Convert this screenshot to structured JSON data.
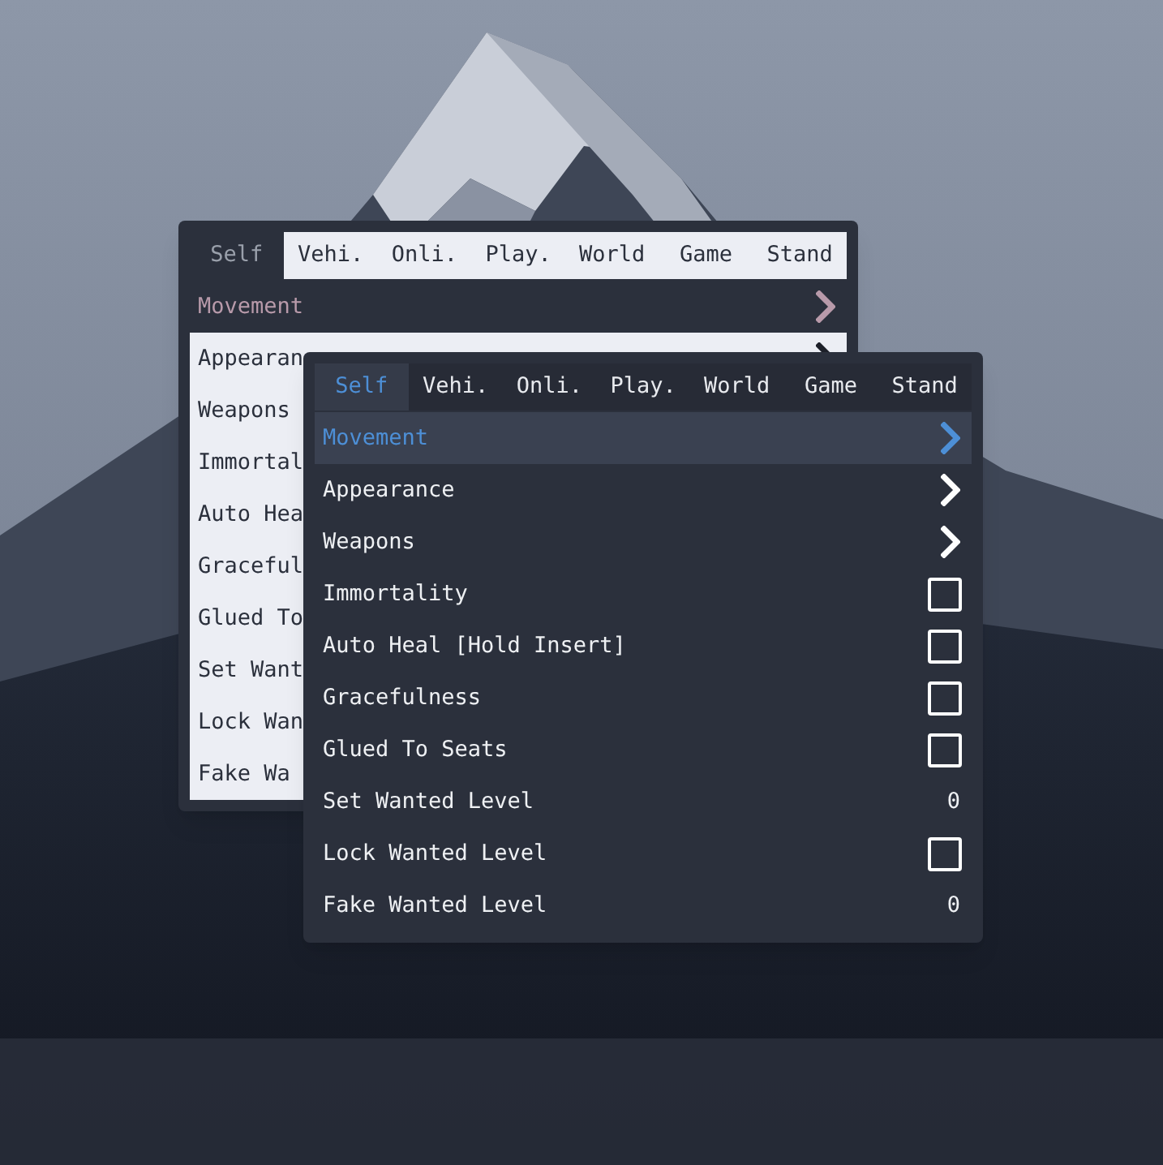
{
  "menus": [
    {
      "active": false,
      "tabs": [
        {
          "label": "Self",
          "selected": true
        },
        {
          "label": "Vehi.",
          "selected": false
        },
        {
          "label": "Onli.",
          "selected": false
        },
        {
          "label": "Play.",
          "selected": false
        },
        {
          "label": "World",
          "selected": false
        },
        {
          "label": "Game",
          "selected": false
        },
        {
          "label": "Stand",
          "selected": false
        }
      ],
      "items": [
        {
          "label": "Movement",
          "kind": "submenu",
          "selected": true
        },
        {
          "label": "Appearan",
          "kind": "submenu",
          "selected": false
        },
        {
          "label": "Weapons",
          "kind": "text",
          "selected": false
        },
        {
          "label": "Immortal",
          "kind": "text",
          "selected": false
        },
        {
          "label": "Auto Hea",
          "kind": "text",
          "selected": false
        },
        {
          "label": "Graceful",
          "kind": "text",
          "selected": false
        },
        {
          "label": "Glued To",
          "kind": "text",
          "selected": false
        },
        {
          "label": "Set Want",
          "kind": "text",
          "selected": false
        },
        {
          "label": "Lock Wan",
          "kind": "text",
          "selected": false
        },
        {
          "label": "Fake Wa",
          "kind": "text",
          "selected": false
        }
      ]
    },
    {
      "active": true,
      "tabs": [
        {
          "label": "Self",
          "selected": true
        },
        {
          "label": "Vehi.",
          "selected": false
        },
        {
          "label": "Onli.",
          "selected": false
        },
        {
          "label": "Play.",
          "selected": false
        },
        {
          "label": "World",
          "selected": false
        },
        {
          "label": "Game",
          "selected": false
        },
        {
          "label": "Stand",
          "selected": false
        }
      ],
      "items": [
        {
          "label": "Movement",
          "kind": "submenu",
          "selected": true
        },
        {
          "label": "Appearance",
          "kind": "submenu",
          "selected": false
        },
        {
          "label": "Weapons",
          "kind": "submenu",
          "selected": false
        },
        {
          "label": "Immortality",
          "kind": "toggle",
          "selected": false,
          "checked": false
        },
        {
          "label": "Auto Heal [Hold Insert]",
          "kind": "toggle",
          "selected": false,
          "checked": false
        },
        {
          "label": "Gracefulness",
          "kind": "toggle",
          "selected": false,
          "checked": false
        },
        {
          "label": "Glued To Seats",
          "kind": "toggle",
          "selected": false,
          "checked": false
        },
        {
          "label": "Set Wanted Level",
          "kind": "value",
          "selected": false,
          "value": "0"
        },
        {
          "label": "Lock Wanted Level",
          "kind": "toggle",
          "selected": false,
          "checked": false
        },
        {
          "label": "Fake Wanted Level",
          "kind": "value",
          "selected": false,
          "value": "0"
        }
      ]
    }
  ]
}
